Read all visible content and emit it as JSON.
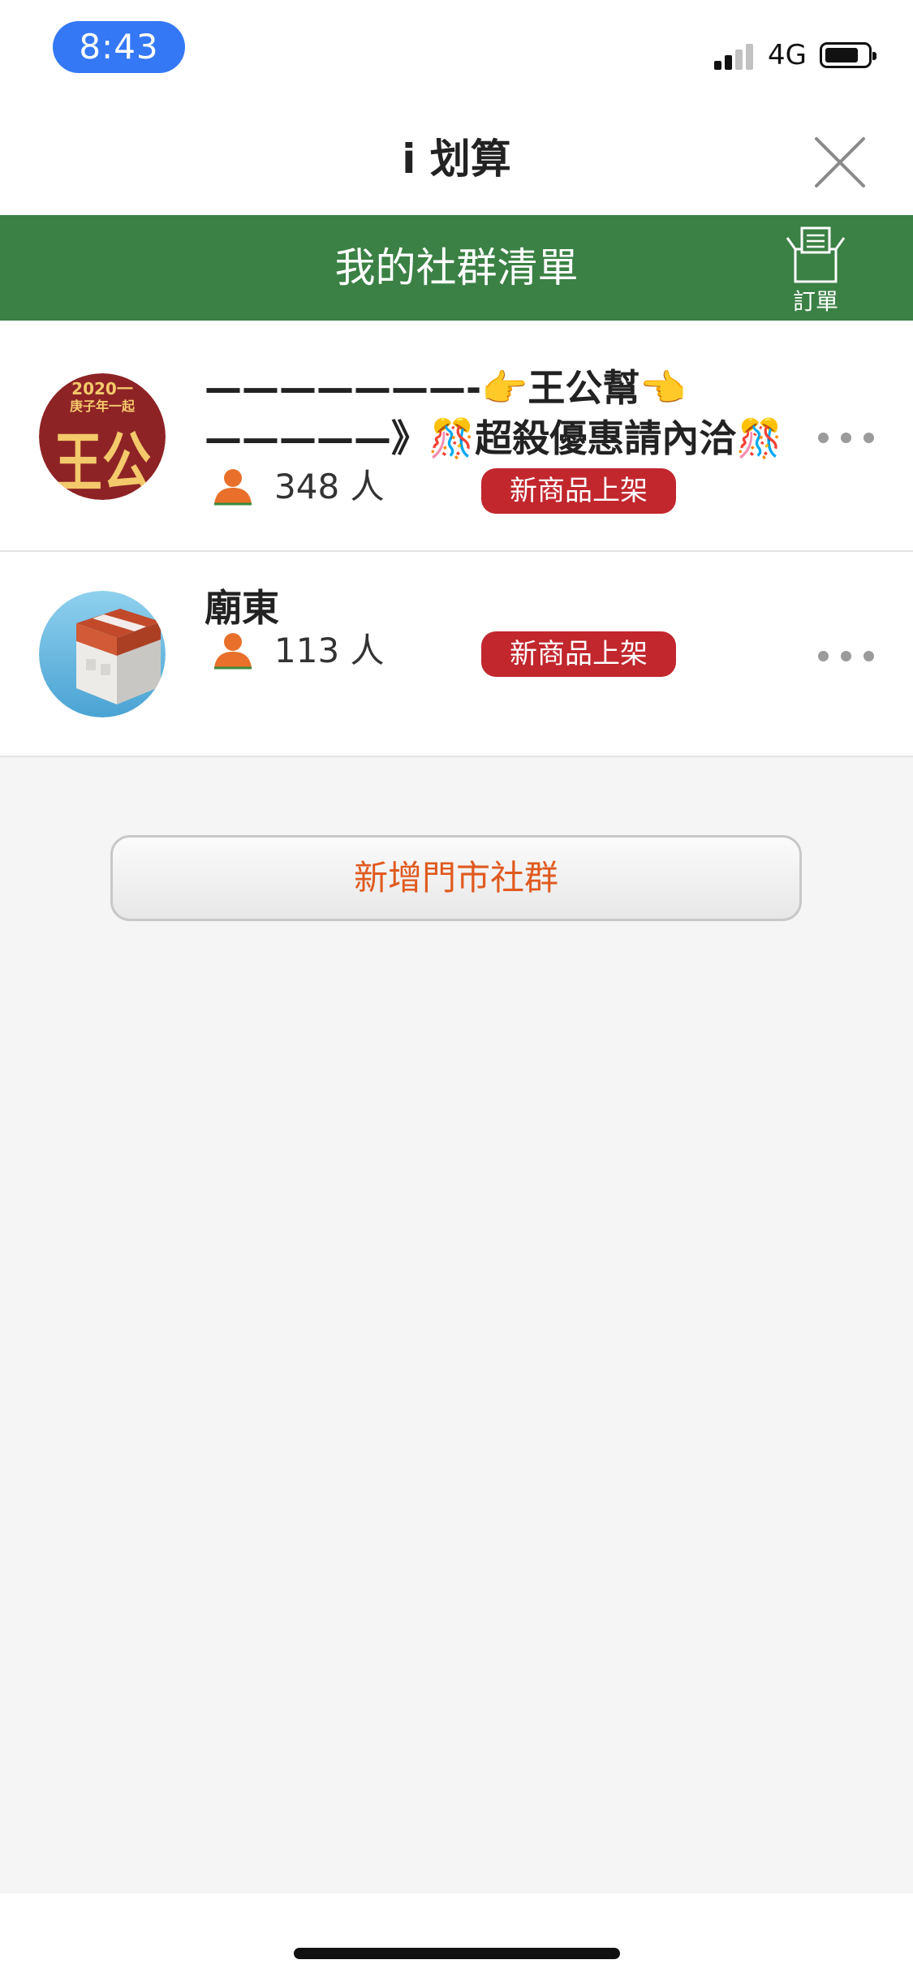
{
  "status_bar": {
    "time": "8:43",
    "network": "4G"
  },
  "nav": {
    "title": "i 划算"
  },
  "header": {
    "title": "我的社群清單",
    "orders_label": "訂單"
  },
  "groups": [
    {
      "name": "———————-👉王公幫👈—————》🎊超殺優惠請內洽🎊",
      "member_count": "348 人",
      "badge": "新商品上架",
      "avatar_text_top": "2020一",
      "avatar_text_mid": "庚子年一起",
      "avatar_text_big": "王公"
    },
    {
      "name": "廟東",
      "member_count": "113 人",
      "badge": "新商品上架"
    }
  ],
  "add_button": {
    "label": "新增門市社群"
  },
  "colors": {
    "header_green": "#3b8044",
    "badge_red": "#c1272d",
    "accent_orange": "#e05a1f",
    "time_pill_blue": "#3478f6"
  }
}
